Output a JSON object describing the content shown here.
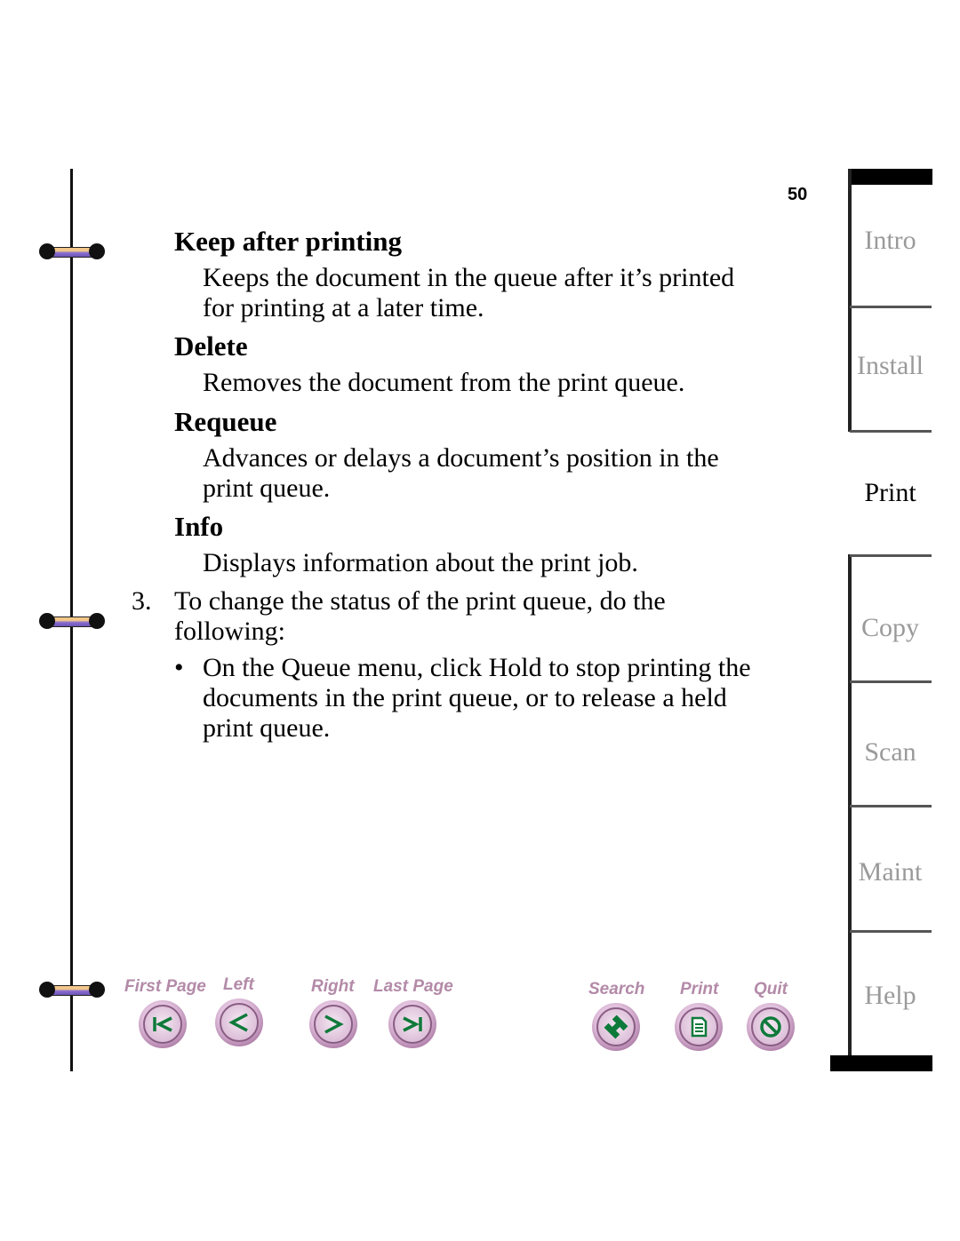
{
  "page_number": "50",
  "sections": [
    {
      "heading": "Keep after printing",
      "body": [
        "Keeps the document in the queue after it’s printed",
        "for printing at a later time."
      ]
    },
    {
      "heading": "Delete",
      "body": [
        "Removes the document from the print queue."
      ]
    },
    {
      "heading": "Requeue",
      "body": [
        "Advances or delays a document’s position in the",
        "print queue."
      ]
    },
    {
      "heading": "Info",
      "body": [
        "Displays information about the print job."
      ]
    }
  ],
  "step": {
    "number": "3.",
    "lines": [
      "To change the status of the print queue, do the",
      "following:"
    ]
  },
  "bullet": {
    "glyph": "•",
    "lines": [
      "On the Queue menu, click Hold to stop printing the",
      "documents in the print queue, or to release a held",
      "print queue."
    ]
  },
  "tabs": [
    {
      "label": "Intro",
      "active": false
    },
    {
      "label": "Install",
      "active": false
    },
    {
      "label": "Print",
      "active": true
    },
    {
      "label": "Copy",
      "active": false
    },
    {
      "label": "Scan",
      "active": false
    },
    {
      "label": "Maint",
      "active": false
    },
    {
      "label": "Help",
      "active": false
    }
  ],
  "nav": {
    "first_page": {
      "label": "First Page",
      "icon": "first-page-icon"
    },
    "left": {
      "label": "Left",
      "icon": "left-arrow-icon"
    },
    "right": {
      "label": "Right",
      "icon": "right-arrow-icon"
    },
    "last_page": {
      "label": "Last Page",
      "icon": "last-page-icon"
    },
    "search": {
      "label": "Search",
      "icon": "search-binoculars-icon"
    },
    "print": {
      "label": "Print",
      "icon": "print-document-icon"
    },
    "quit": {
      "label": "Quit",
      "icon": "quit-no-icon"
    }
  },
  "colors": {
    "icon_green": "#0e7a3a",
    "nav_label": "#b38aa8",
    "inactive_tab": "#9a9a9a"
  }
}
